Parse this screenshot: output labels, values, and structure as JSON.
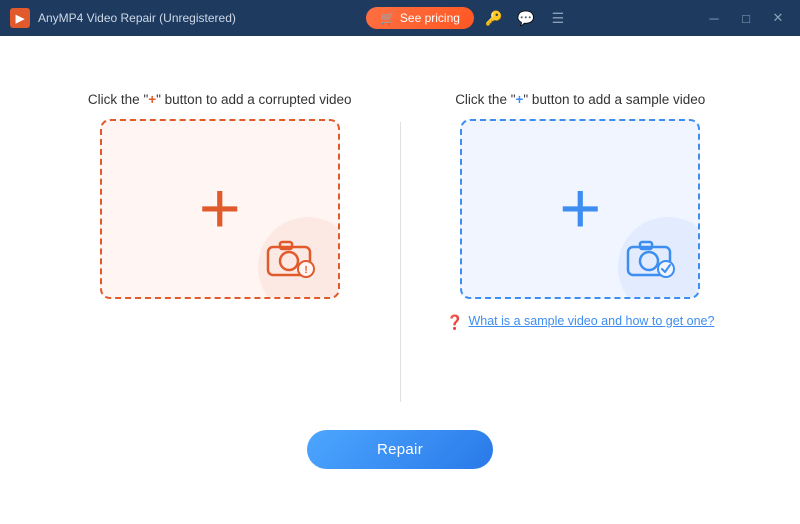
{
  "titleBar": {
    "appIcon": "▶",
    "title": "AnyMP4 Video Repair (Unregistered)",
    "seePricingLabel": "See pricing",
    "icons": {
      "key": "🔑",
      "chat": "💬",
      "menu": "☰",
      "minimize": "─",
      "maximize": "□",
      "close": "✕"
    }
  },
  "leftPanel": {
    "labelPart1": "Click the \"",
    "labelPlus": "+",
    "labelPart2": "\" button to add a corrupted video"
  },
  "rightPanel": {
    "labelPart1": "Click the \"",
    "labelPlus": "+",
    "labelPart2": "\" button to add a sample video",
    "helperText": "What is a sample video and how to get one?"
  },
  "repairButton": {
    "label": "Repair"
  }
}
